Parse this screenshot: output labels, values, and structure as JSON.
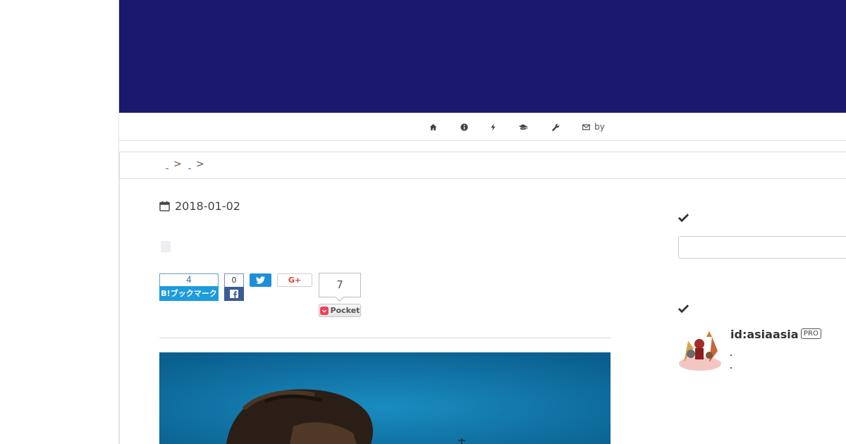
{
  "header": {
    "banner_color": "#1b196e"
  },
  "nav": {
    "items": [
      {
        "icon": "home-icon"
      },
      {
        "icon": "info-icon"
      },
      {
        "icon": "bolt-icon"
      },
      {
        "icon": "graduation-cap-icon"
      },
      {
        "icon": "wrench-icon"
      },
      {
        "icon": "envelope-icon",
        "label": "by"
      }
    ]
  },
  "breadcrumb": {
    "separator": ">"
  },
  "article": {
    "date": "2018-01-02"
  },
  "share": {
    "hatena_count": "4",
    "hatena_label": "B!ブックマーク",
    "facebook_count": "0",
    "googleplus_label": "G+",
    "pocket_count": "7",
    "pocket_label": "Pocket"
  },
  "sidebar": {
    "profile": {
      "name": "id:asiaasia",
      "badge": "PRO"
    }
  }
}
